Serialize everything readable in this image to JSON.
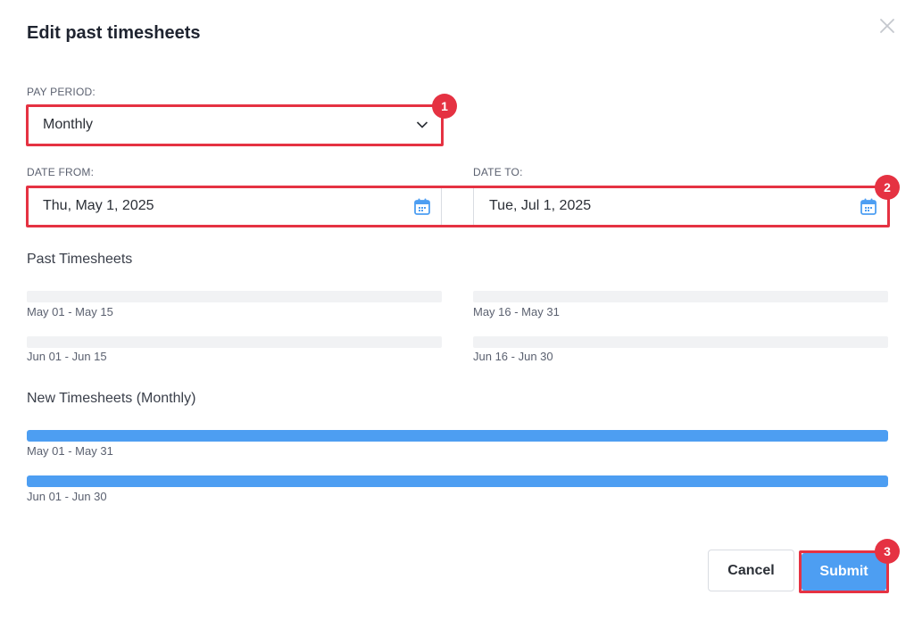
{
  "dialog": {
    "title": "Edit past timesheets",
    "close_icon": "close-icon"
  },
  "pay_period": {
    "label": "PAY PERIOD:",
    "value": "Monthly",
    "icon": "chevron-down-icon"
  },
  "date_from": {
    "label": "DATE FROM:",
    "value": "Thu, May 1, 2025",
    "icon": "calendar-icon"
  },
  "date_to": {
    "label": "DATE TO:",
    "value": "Tue, Jul 1, 2025",
    "icon": "calendar-icon"
  },
  "past_timesheets": {
    "title": "Past Timesheets",
    "items": [
      {
        "label": "May 01 - May 15"
      },
      {
        "label": "May 16 - May 31"
      },
      {
        "label": "Jun 01 - Jun 15"
      },
      {
        "label": "Jun 16 - Jun 30"
      }
    ]
  },
  "new_timesheets": {
    "title": "New Timesheets (Monthly)",
    "items": [
      {
        "label": "May 01 - May 31"
      },
      {
        "label": "Jun 01 - Jun 30"
      }
    ]
  },
  "buttons": {
    "cancel": "Cancel",
    "submit": "Submit"
  },
  "markers": [
    "1",
    "2",
    "3"
  ],
  "colors": {
    "accent": "#4d9ef2",
    "highlight": "#e53242",
    "placeholder_bar": "#f1f2f4"
  }
}
